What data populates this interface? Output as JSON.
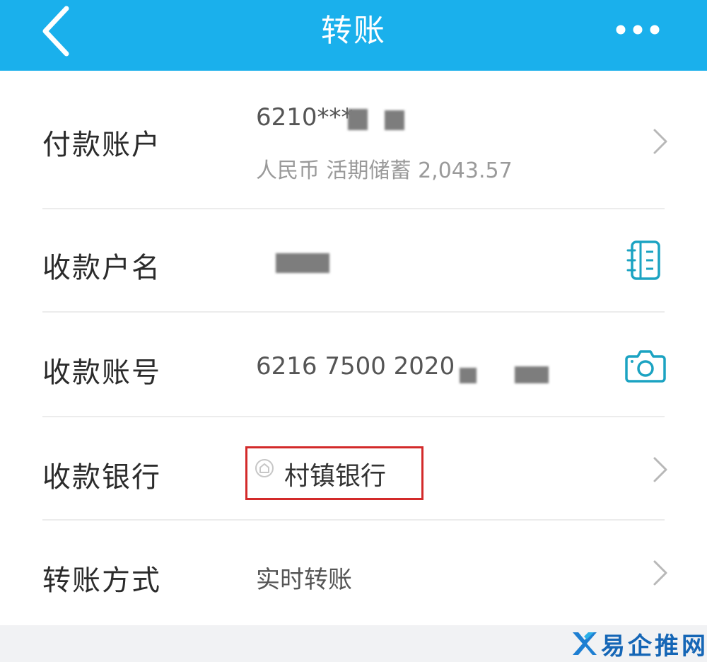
{
  "header": {
    "title": "转账",
    "back_icon": "chevron-left-icon",
    "more_icon": "more-dots-icon",
    "background_color": "#1ab0ec"
  },
  "rows": {
    "payer": {
      "label": "付款账户",
      "account": "6210***",
      "details": "人民币  活期储蓄  2,043.57",
      "action_icon": "chevron-right-icon"
    },
    "payee_name": {
      "label": "收款户名",
      "action_icon": "address-book-icon"
    },
    "payee_account": {
      "label": "收款账号",
      "account": "6216 7500 2020",
      "action_icon": "camera-icon"
    },
    "payee_bank": {
      "label": "收款银行",
      "bank": "村镇银行",
      "bank_icon": "bank-logo-icon",
      "action_icon": "chevron-right-icon"
    },
    "transfer_method": {
      "label": "转账方式",
      "method": "实时转账",
      "action_icon": "chevron-right-icon"
    }
  },
  "watermark": {
    "text": "易企推网络",
    "logo_icon": "watermark-logo-icon",
    "color": "#1566b6"
  },
  "colors": {
    "accent": "#1ab0ec",
    "icon_teal": "#1ba3c2",
    "highlight_border": "#d32a2a"
  }
}
